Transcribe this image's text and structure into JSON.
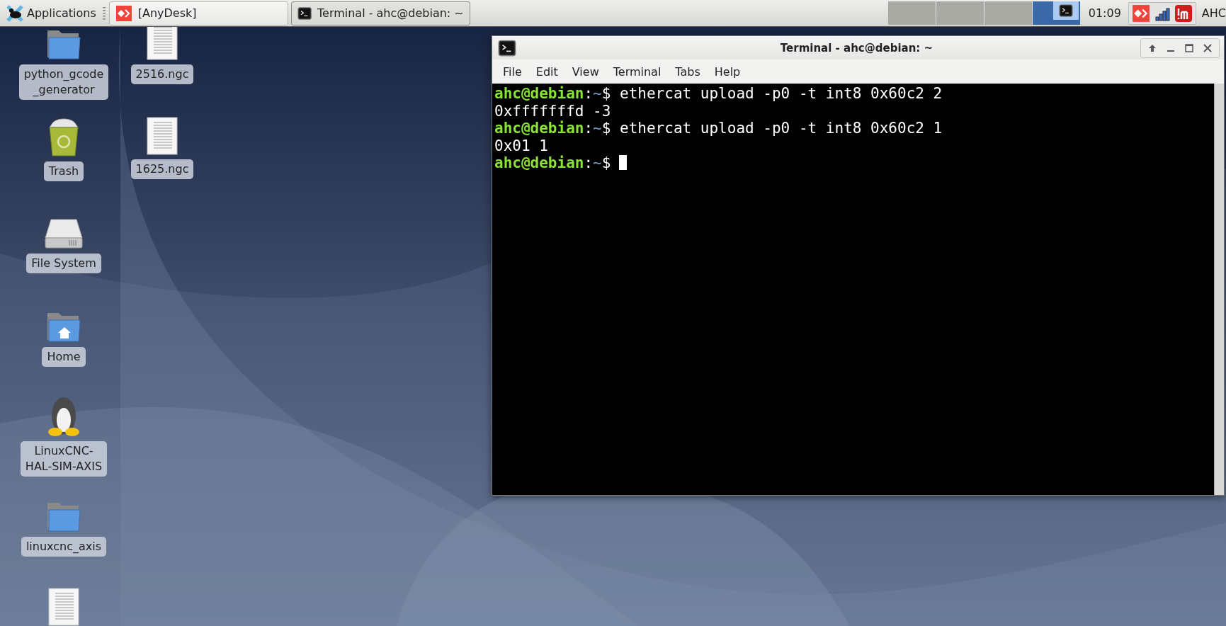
{
  "top_panel": {
    "apps_menu": "Applications",
    "tasks": [
      {
        "kind": "anydesk",
        "label": "[AnyDesk]",
        "selected": false
      },
      {
        "kind": "terminal",
        "label": "Terminal - ahc@debian: ~",
        "selected": true
      }
    ],
    "workspaces": [
      {
        "selected": false
      },
      {
        "selected": false
      },
      {
        "selected": false
      },
      {
        "selected": true
      }
    ],
    "clock": "01:09",
    "user": "AHC"
  },
  "desktop_icons": [
    {
      "kind": "folder",
      "label": [
        "python_gcode",
        "_generator"
      ]
    },
    {
      "kind": "document",
      "label": [
        "2516.ngc"
      ]
    },
    {
      "kind": "trash",
      "label": [
        "Trash"
      ]
    },
    {
      "kind": "document",
      "label": [
        "1625.ngc"
      ]
    },
    {
      "kind": "drive",
      "label": [
        "File System"
      ]
    },
    {
      "kind": "home",
      "label": [
        "Home"
      ]
    },
    {
      "kind": "penguin",
      "label": [
        "LinuxCNC-",
        "HAL-SIM-AXIS"
      ]
    },
    {
      "kind": "folder",
      "label": [
        "linuxcnc_axis"
      ]
    },
    {
      "kind": "document"
    }
  ],
  "terminal_window": {
    "title": "Terminal - ahc@debian: ~",
    "menu": [
      "File",
      "Edit",
      "View",
      "Terminal",
      "Tabs",
      "Help"
    ],
    "lines": [
      {
        "kind": "prompt",
        "host": "ahc@debian",
        "colon": ":",
        "path": "~",
        "dollar": "$",
        "command": "ethercat upload -p0 -t int8 0x60c2 2"
      },
      {
        "kind": "output",
        "text": "0xfffffffd -3"
      },
      {
        "kind": "prompt",
        "host": "ahc@debian",
        "colon": ":",
        "path": "~",
        "dollar": "$",
        "command": "ethercat upload -p0 -t int8 0x60c2 1"
      },
      {
        "kind": "output",
        "text": "0x01 1"
      },
      {
        "kind": "prompt",
        "host": "ahc@debian",
        "colon": ":",
        "path": "~",
        "dollar": "$",
        "cursor": true
      }
    ]
  }
}
